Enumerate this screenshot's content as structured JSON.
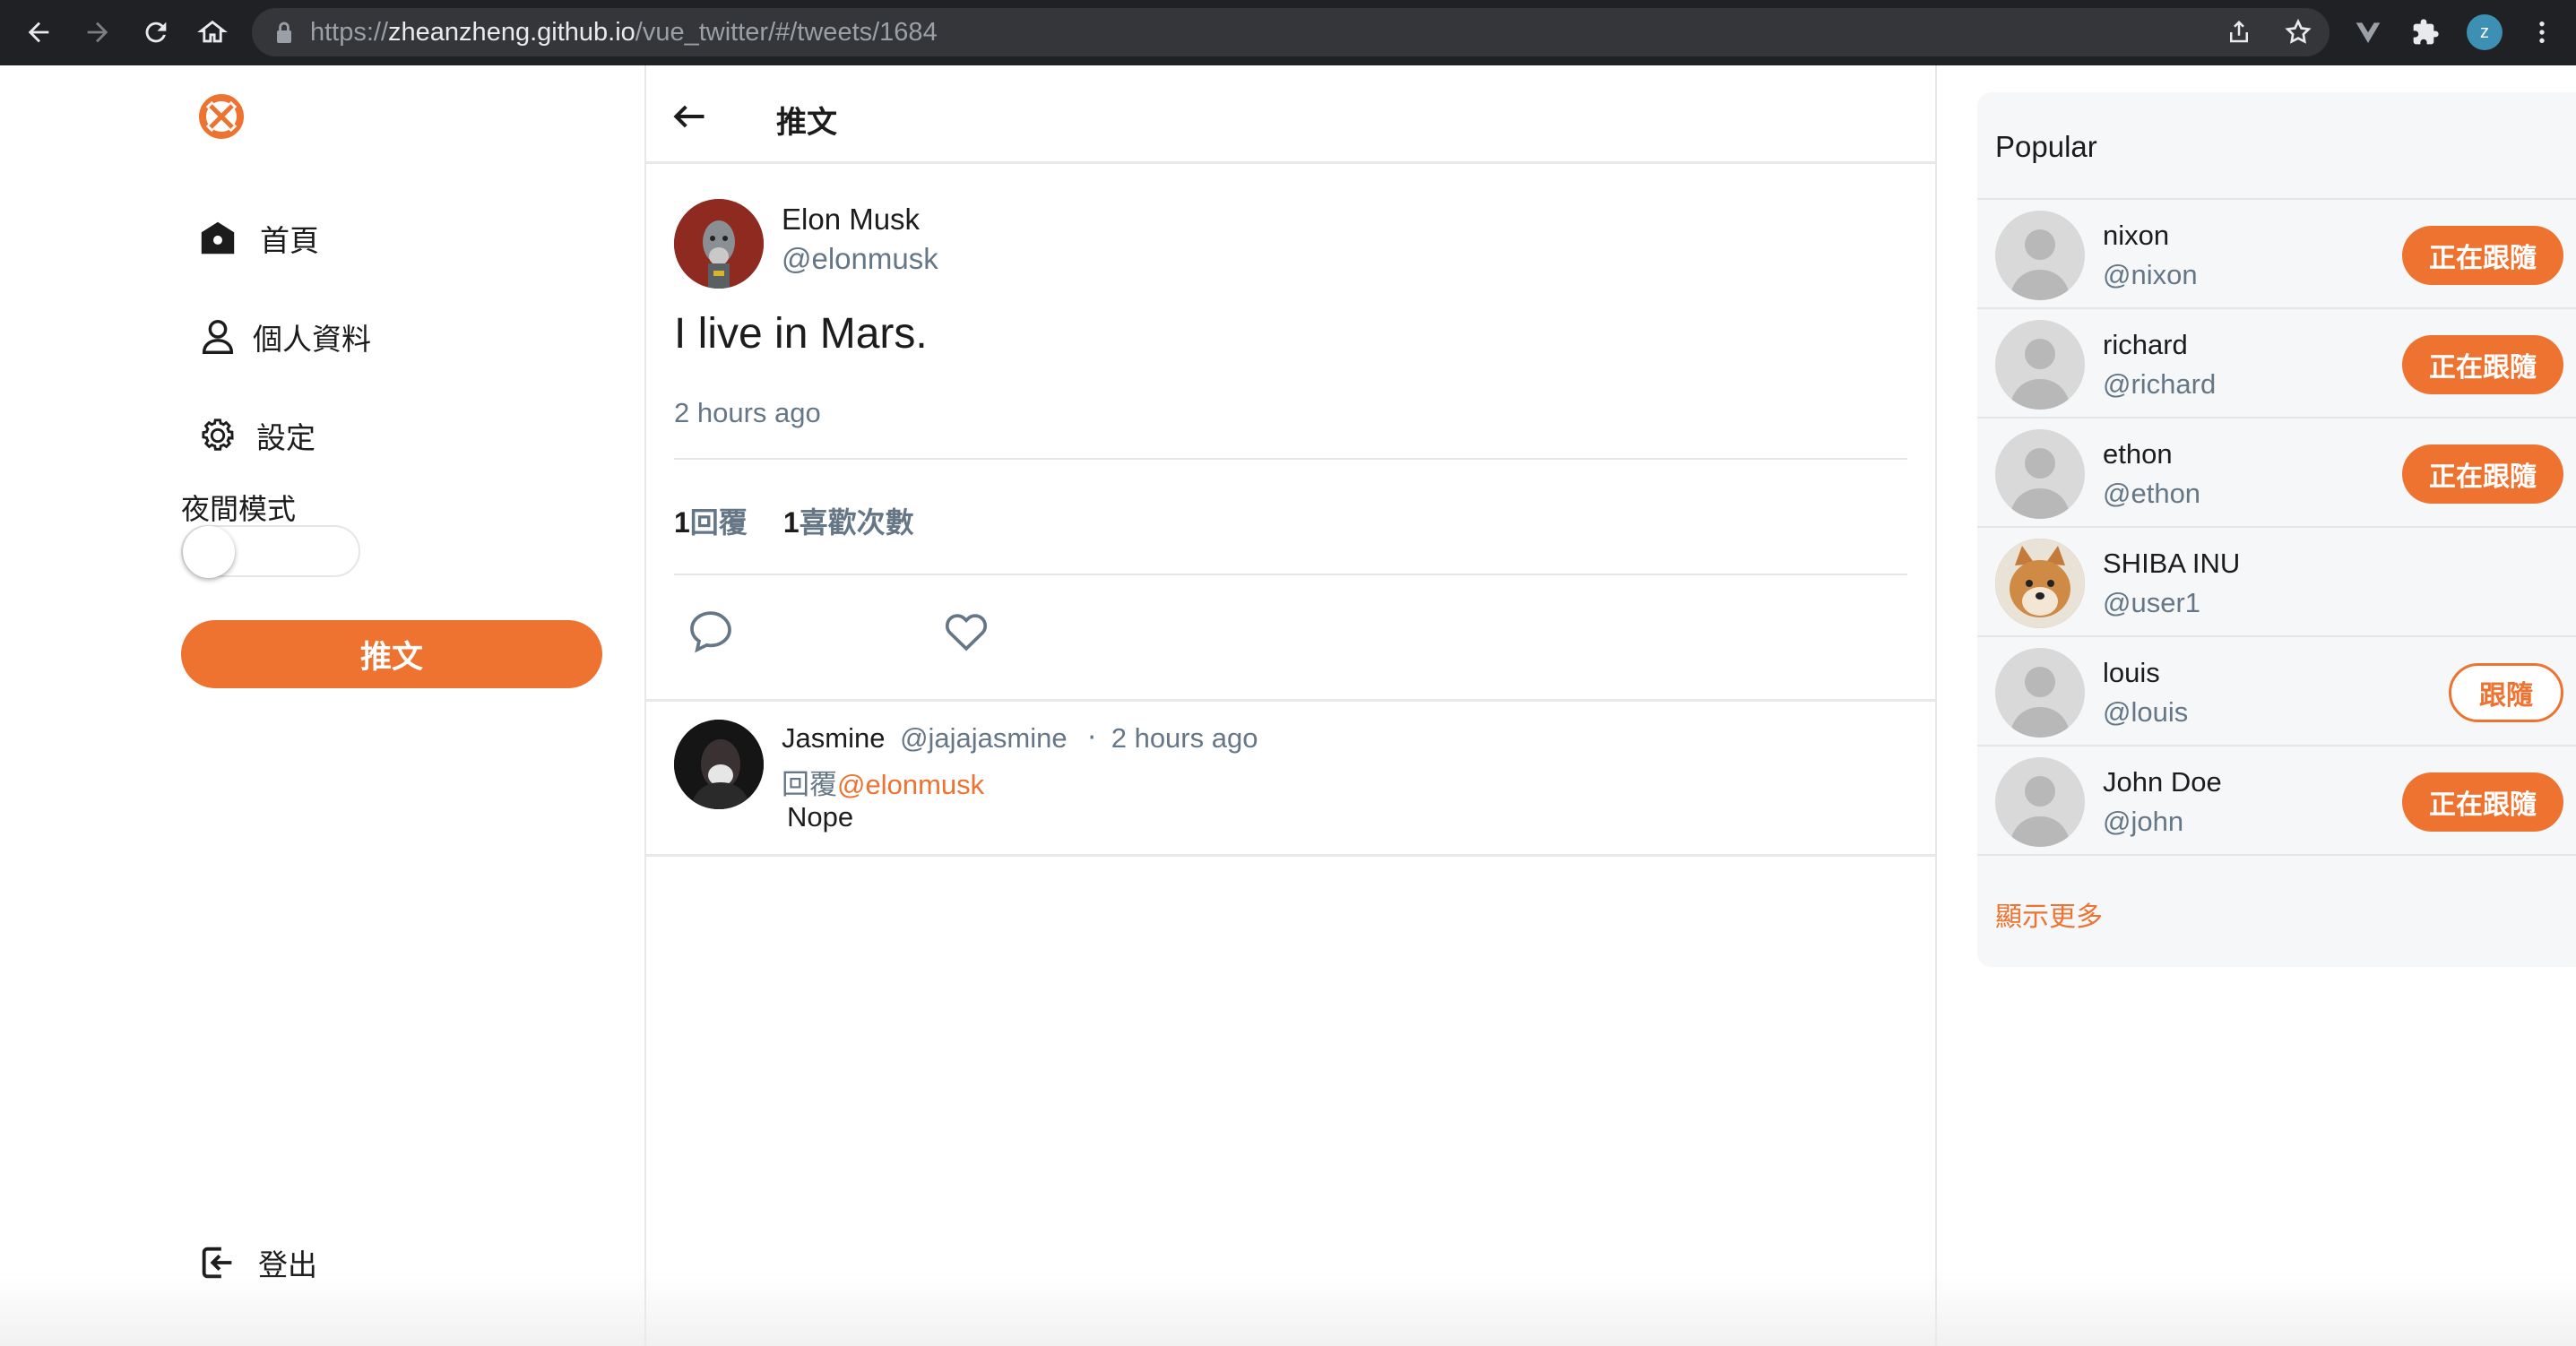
{
  "browser": {
    "url_host": "zheanzheng.github.io",
    "url_prefix": "https://",
    "url_path": "/vue_twitter/#/tweets/1684",
    "profile_initial": "z"
  },
  "sidebar": {
    "items": [
      {
        "label": "首頁",
        "icon": "home-icon"
      },
      {
        "label": "個人資料",
        "icon": "user-icon"
      },
      {
        "label": "設定",
        "icon": "gear-icon"
      }
    ],
    "night_mode_label": "夜間模式",
    "night_mode_on": false,
    "tweet_button": "推文",
    "logout_label": "登出"
  },
  "main": {
    "title": "推文",
    "tweet": {
      "author_name": "Elon Musk",
      "author_handle": "@elonmusk",
      "text": "I live in Mars.",
      "time": "2 hours ago",
      "reply_count": "1",
      "reply_label": "回覆",
      "like_count": "1",
      "like_label": "喜歡次數"
    },
    "replies": [
      {
        "name": "Jasmine",
        "handle": "@jajajasmine",
        "separator": "‧",
        "time": "2 hours ago",
        "reply_prefix": "回覆",
        "reply_mention": "@elonmusk",
        "text": "Nope"
      }
    ]
  },
  "popular": {
    "title": "Popular",
    "users": [
      {
        "name": "nixon",
        "handle": "@nixon",
        "button": "正在跟隨",
        "following": true
      },
      {
        "name": "richard",
        "handle": "@richard",
        "button": "正在跟隨",
        "following": true
      },
      {
        "name": "ethon",
        "handle": "@ethon",
        "button": "正在跟隨",
        "following": true
      },
      {
        "name": "SHIBA INU",
        "handle": "@user1",
        "button": "",
        "following": null
      },
      {
        "name": "louis",
        "handle": "@louis",
        "button": "跟隨",
        "following": false
      },
      {
        "name": "John Doe",
        "handle": "@john",
        "button": "正在跟隨",
        "following": true
      }
    ],
    "show_more": "顯示更多"
  },
  "colors": {
    "accent": "#ee7330",
    "muted": "#657786",
    "chrome_bg": "#202124"
  }
}
